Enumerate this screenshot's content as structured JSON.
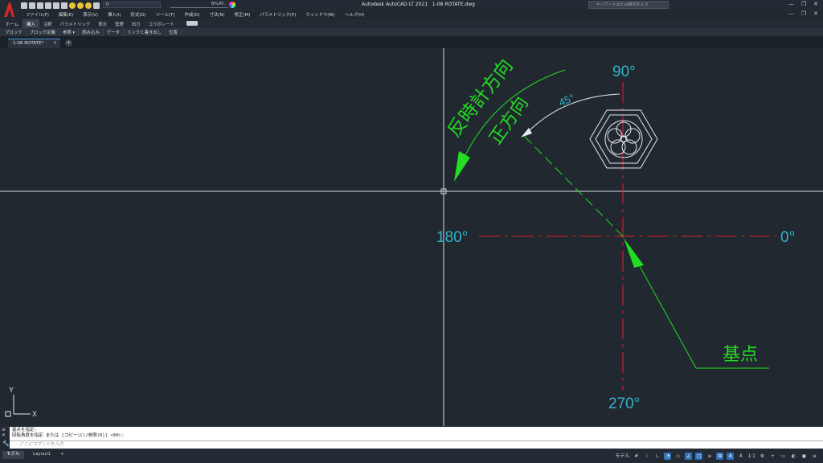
{
  "app": {
    "title": "Autodesk AutoCAD LT 2021",
    "file": "1-08 ROTATE.dwg",
    "search_placeholder": "キーワードまたは語句を入力"
  },
  "quick_access": {
    "layer_value": "0",
    "linetype_value": "BYLAY..."
  },
  "menu": [
    "ファイル(F)",
    "編集(E)",
    "表示(V)",
    "挿入(I)",
    "形式(O)",
    "ツール(T)",
    "作成(D)",
    "寸法(N)",
    "修正(M)",
    "パラメトリック(P)",
    "ウィンドウ(W)",
    "ヘルプ(H)"
  ],
  "ribbon": {
    "tabs": [
      "ホーム",
      "挿入",
      "注釈",
      "パラメトリック",
      "表示",
      "管理",
      "出力",
      "コラボレート"
    ],
    "active_tab": "挿入",
    "panels": [
      "ブロック",
      "ブロック定義",
      "参照 ▾",
      "読み込み",
      "データ",
      "リンクと書き出し",
      "位置"
    ]
  },
  "file_tab": {
    "label": "1-08 ROTATE*",
    "close": "×",
    "new": "+"
  },
  "drawing": {
    "angle_90": "90°",
    "angle_180": "180°",
    "angle_0": "0°",
    "angle_270": "270°",
    "angle_45": "45°",
    "ccw_label": "反時計方向",
    "positive_label": "正方向",
    "base_point_label": "基点",
    "ucs_x": "X",
    "ucs_y": "Y",
    "colors": {
      "background": "#212830",
      "crosshair": "#d9dde2",
      "green": "#22dd22",
      "red": "#e02424",
      "cyan": "#33b2c8",
      "white": "#e6e9ec"
    }
  },
  "command_line": {
    "history": [
      "基点を指定:",
      "回転角度を指定 または [コピー(C)/参照(R)] <90>:"
    ],
    "input_placeholder": "ここにコマンドを入力"
  },
  "status": {
    "layout_tabs": [
      "モデル",
      "Layout1",
      "+"
    ],
    "model_button": "モデル",
    "scale": "1:1"
  }
}
